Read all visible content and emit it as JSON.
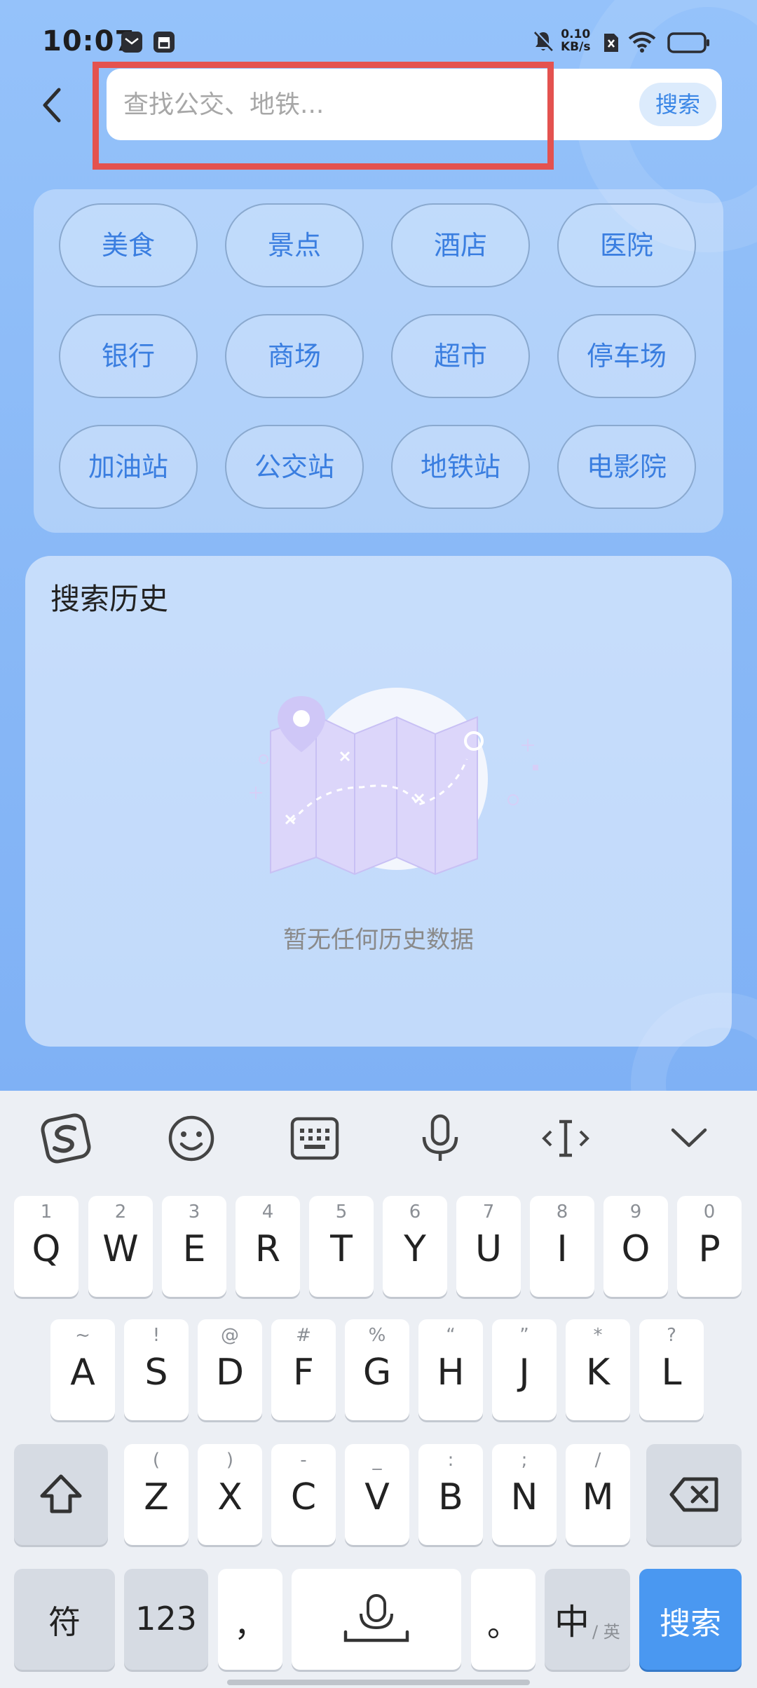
{
  "status_bar": {
    "time": "10:07",
    "net_speed_value": "0.10",
    "net_speed_unit": "KB/s"
  },
  "header": {
    "search_placeholder": "查找公交、地铁...",
    "search_button": "搜索"
  },
  "categories": [
    "美食",
    "景点",
    "酒店",
    "医院",
    "银行",
    "商场",
    "超市",
    "停车场",
    "加油站",
    "公交站",
    "地铁站",
    "电影院"
  ],
  "history": {
    "title": "搜索历史",
    "empty_text": "暂无任何历史数据"
  },
  "keyboard": {
    "toolbar_icons": [
      "sogou-logo-icon",
      "emoji-icon",
      "keyboard-icon",
      "microphone-icon",
      "cursor-icon",
      "collapse-chevron-icon"
    ],
    "row1": [
      {
        "main": "Q",
        "sub": "1"
      },
      {
        "main": "W",
        "sub": "2"
      },
      {
        "main": "E",
        "sub": "3"
      },
      {
        "main": "R",
        "sub": "4"
      },
      {
        "main": "T",
        "sub": "5"
      },
      {
        "main": "Y",
        "sub": "6"
      },
      {
        "main": "U",
        "sub": "7"
      },
      {
        "main": "I",
        "sub": "8"
      },
      {
        "main": "O",
        "sub": "9"
      },
      {
        "main": "P",
        "sub": "0"
      }
    ],
    "row2": [
      {
        "main": "A",
        "sub": "~"
      },
      {
        "main": "S",
        "sub": "!"
      },
      {
        "main": "D",
        "sub": "@"
      },
      {
        "main": "F",
        "sub": "#"
      },
      {
        "main": "G",
        "sub": "%"
      },
      {
        "main": "H",
        "sub": "“"
      },
      {
        "main": "J",
        "sub": "”"
      },
      {
        "main": "K",
        "sub": "*"
      },
      {
        "main": "L",
        "sub": "?"
      }
    ],
    "row3": [
      {
        "main": "Z",
        "sub": "("
      },
      {
        "main": "X",
        "sub": ")"
      },
      {
        "main": "C",
        "sub": "-"
      },
      {
        "main": "V",
        "sub": "_"
      },
      {
        "main": "B",
        "sub": ":"
      },
      {
        "main": "N",
        "sub": ";"
      },
      {
        "main": "M",
        "sub": "/"
      }
    ],
    "symbols_key": "符",
    "numbers_key": "123",
    "comma_key": "，",
    "period_key": "。",
    "lang_main": "中",
    "lang_sub": "/ 英",
    "enter_key": "搜索",
    "accent_color": "#4a98f1"
  }
}
